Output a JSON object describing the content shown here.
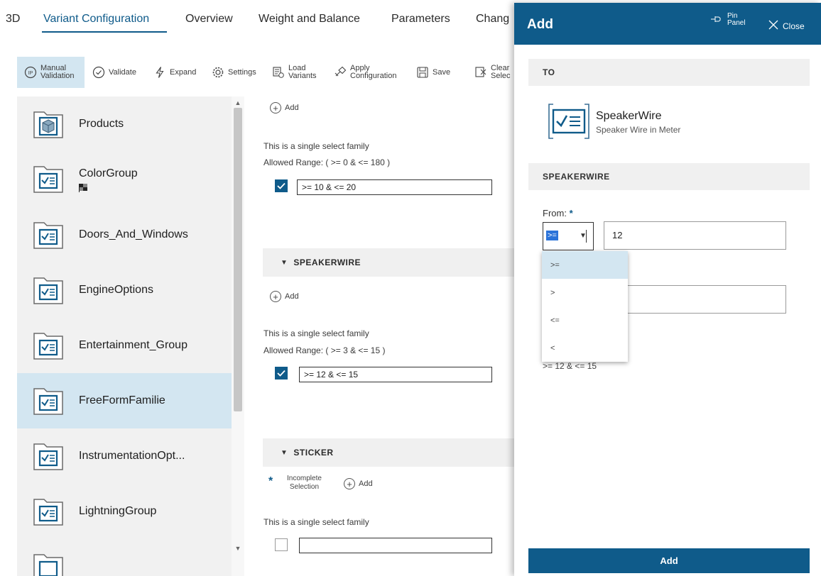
{
  "tabs": [
    {
      "label": "3D"
    },
    {
      "label": "Variant Configuration"
    },
    {
      "label": "Overview"
    },
    {
      "label": "Weight and Balance"
    },
    {
      "label": "Parameters"
    },
    {
      "label": "Chang"
    }
  ],
  "toolbar": {
    "manual_validation": [
      "Manual",
      "Validation"
    ],
    "validate": "Validate",
    "expand": "Expand",
    "settings": "Settings",
    "load_variants": [
      "Load",
      "Variants"
    ],
    "apply_configuration": [
      "Apply",
      "Configuration"
    ],
    "save": "Save",
    "clear_selection": [
      "Clear",
      "Selec"
    ]
  },
  "families": [
    {
      "label": "Products",
      "icon": "cube-icon"
    },
    {
      "label": "ColorGroup",
      "icon": "checklist-icon"
    },
    {
      "label": "Doors_And_Windows",
      "icon": "checklist-icon"
    },
    {
      "label": "EngineOptions",
      "icon": "checklist-icon"
    },
    {
      "label": "Entertainment_Group",
      "icon": "checklist-icon"
    },
    {
      "label": "FreeFormFamilie",
      "icon": "checklist-icon",
      "selected": true
    },
    {
      "label": "InstrumentationOpt...",
      "icon": "checklist-icon"
    },
    {
      "label": "LightningGroup",
      "icon": "checklist-icon"
    }
  ],
  "middle": {
    "add_label": "Add",
    "single_select_text": "This is a single select family",
    "allowed_range_prefix": "Allowed Range:",
    "block1": {
      "allowed": "( >= 0 & <= 180 )",
      "value": ">= 10 & <= 20",
      "checked": true
    },
    "speakerwire": {
      "title": "SPEAKERWIRE",
      "allowed": "( >= 3 & <= 15 )",
      "value": ">= 12 & <= 15",
      "checked": true
    },
    "sticker": {
      "title": "STICKER",
      "incomplete": [
        "Incomplete",
        "Selection"
      ],
      "value": "",
      "checked": false
    }
  },
  "panel": {
    "title": "Add",
    "pin": [
      "Pin",
      "Panel"
    ],
    "close": "Close",
    "to_header": "TO",
    "object_name": "SpeakerWire",
    "object_desc": "Speaker Wire in Meter",
    "section_header": "SPEAKERWIRE",
    "from_label": "From:",
    "required_mark": "*",
    "from_operator": ">=",
    "from_value": "12",
    "operators": [
      ">=",
      ">",
      "<=",
      "<"
    ],
    "preview": ">= 12 & <= 15",
    "add_button": "Add"
  },
  "colors": {
    "accent": "#0f5b8a",
    "selected_bg": "#d3e6f1",
    "highlight_text": "#2b73d9"
  }
}
